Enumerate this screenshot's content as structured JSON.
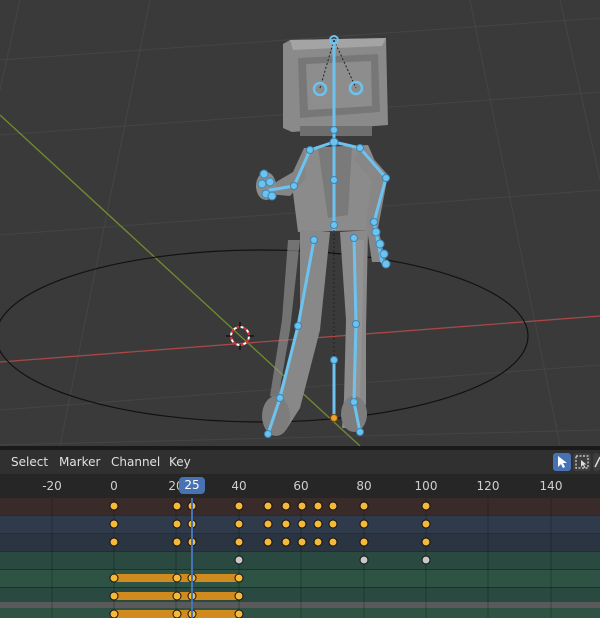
{
  "menu": {
    "select": "Select",
    "marker": "Marker",
    "channel": "Channel",
    "key": "Key"
  },
  "timeline": {
    "current_frame": "25",
    "ticks": [
      "-20",
      "0",
      "20",
      "40",
      "60",
      "80",
      "100",
      "120",
      "140"
    ]
  },
  "colors": {
    "accent": "#4772b3",
    "keyframe_selected": "#f5b93a",
    "keyframe_unselected": "#c8c8c8",
    "hold_bar": "#d08a1e",
    "bone": "#6cc3f0",
    "axis_x": "#b04848",
    "axis_y": "#6f8d2f"
  },
  "icons": {
    "tweak": "cursor-arrow-icon",
    "box_select": "box-select-icon"
  }
}
